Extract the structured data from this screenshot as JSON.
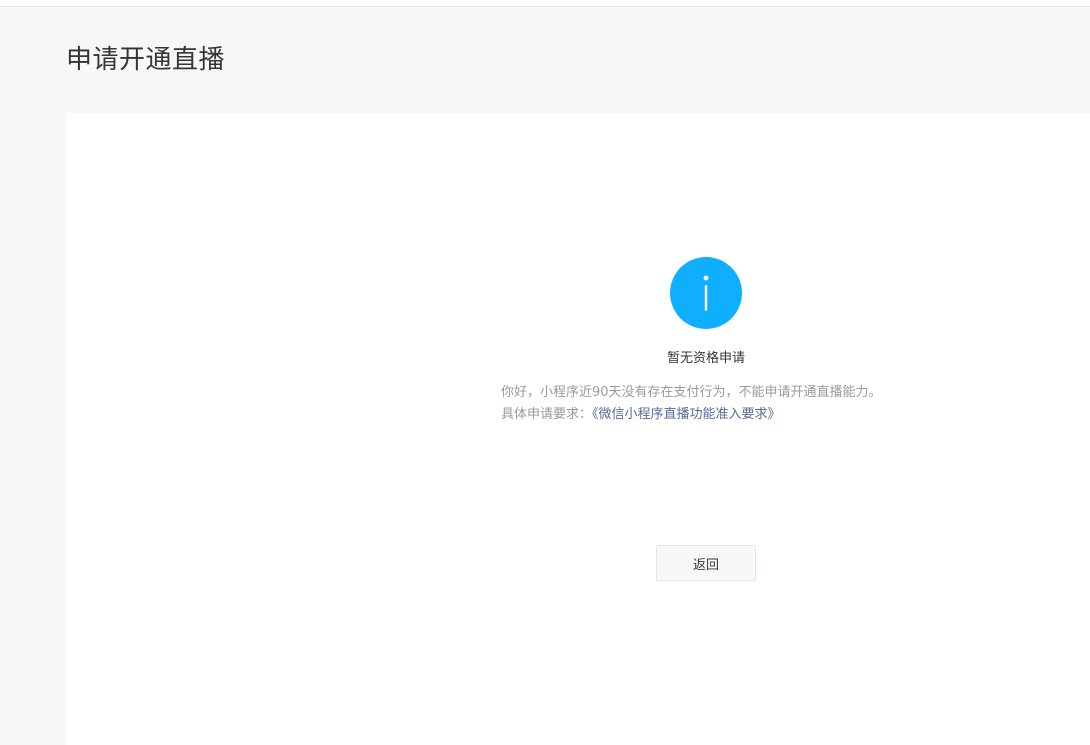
{
  "page": {
    "title": "申请开通直播"
  },
  "result": {
    "icon": "info-circle-icon",
    "icon_color": "#10aeff",
    "title": "暂无资格申请",
    "description_line1": "你好，小程序近90天没有存在支付行为，不能申请开通直播能力。",
    "requirement_label": "具体申请要求：",
    "requirement_link": "《微信小程序直播功能准入要求》"
  },
  "actions": {
    "back_label": "返回"
  },
  "colors": {
    "link": "#576b95",
    "background": "#f6f7f9",
    "card": "#ffffff"
  }
}
